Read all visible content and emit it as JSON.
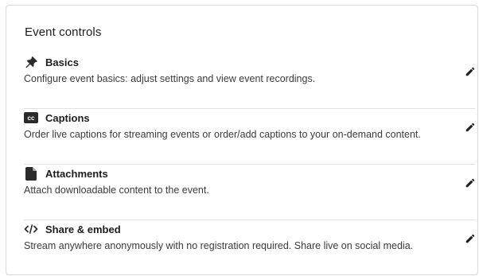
{
  "panel": {
    "title": "Event controls"
  },
  "items": [
    {
      "label": "Basics",
      "description": "Configure event basics: adjust settings and view event recordings.",
      "icon": "pin-icon"
    },
    {
      "label": "Captions",
      "description": "Order live captions for streaming events or order/add captions to your on-demand content.",
      "icon": "closed-captions-icon",
      "icon_text": "cc"
    },
    {
      "label": "Attachments",
      "description": "Attach downloadable content to the event.",
      "icon": "document-icon"
    },
    {
      "label": "Share & embed",
      "description": "Stream anywhere anonymously with no registration required. Share live on social media.",
      "icon": "code-icon"
    }
  ],
  "edit_icon": "pencil-icon",
  "colors": {
    "text": "#1c1c1c",
    "secondary_text": "#3a3a3a",
    "divider": "#e1e1e1",
    "border": "#d9d9d9",
    "icon": "#2b2b2b"
  }
}
